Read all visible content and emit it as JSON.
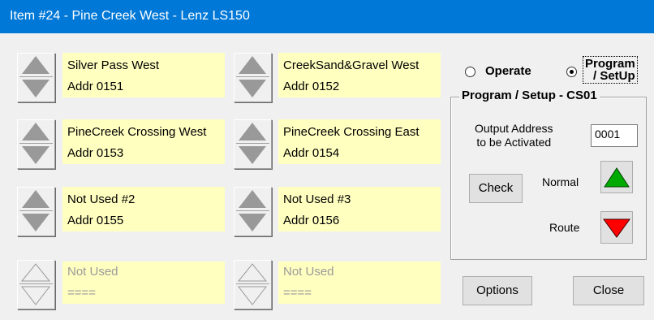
{
  "window": {
    "title": "Item #24 - Pine Creek West - Lenz LS150"
  },
  "turnouts": [
    {
      "name": "Silver Pass West",
      "addr": "Addr 0151",
      "enabled": true
    },
    {
      "name": "CreekSand&Gravel West",
      "addr": "Addr 0152",
      "enabled": true
    },
    {
      "name": "PineCreek Crossing West",
      "addr": "Addr 0153",
      "enabled": true
    },
    {
      "name": "PineCreek Crossing East",
      "addr": "Addr 0154",
      "enabled": true
    },
    {
      "name": "Not Used #2",
      "addr": "Addr 0155",
      "enabled": true
    },
    {
      "name": "Not Used #3",
      "addr": "Addr 0156",
      "enabled": true
    },
    {
      "name": "Not Used",
      "addr": "====",
      "enabled": false
    },
    {
      "name": "Not Used",
      "addr": "====",
      "enabled": false
    }
  ],
  "mode": {
    "operate_label": "Operate",
    "program_label_line1": "Program",
    "program_label_line2": "/ SetUp",
    "selected": "program"
  },
  "program_setup": {
    "title": "Program / Setup  -  CS01",
    "output_label_line1": "Output Address",
    "output_label_line2": "to be Activated",
    "output_address": "0001",
    "check_label": "Check",
    "normal_label": "Normal",
    "route_label": "Route",
    "normal_color": "#00aa00",
    "route_color": "#ff0000"
  },
  "footer": {
    "options_label": "Options",
    "close_label": "Close"
  }
}
